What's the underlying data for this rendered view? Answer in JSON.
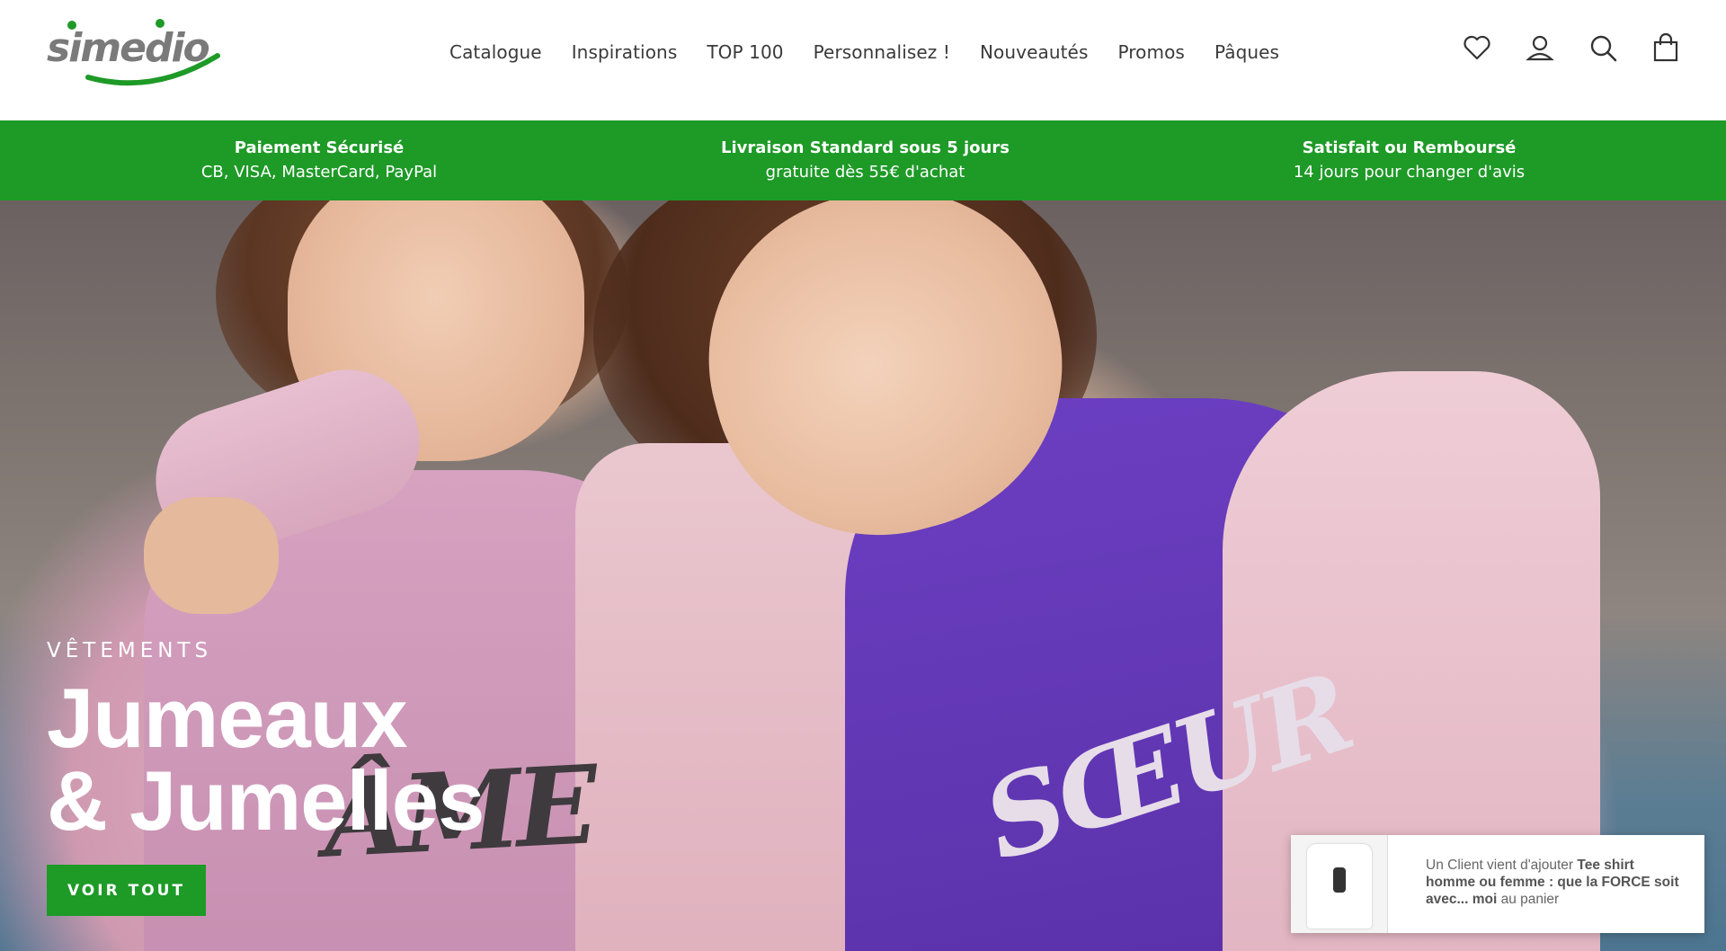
{
  "brand": {
    "logo_text": "simedio",
    "accent_color": "#1e9a27"
  },
  "nav": {
    "items": [
      {
        "label": "Catalogue"
      },
      {
        "label": "Inspirations"
      },
      {
        "label": "TOP 100"
      },
      {
        "label": "Personnalisez !"
      },
      {
        "label": "Nouveautés"
      },
      {
        "label": "Promos"
      },
      {
        "label": "Pâques"
      }
    ]
  },
  "header_icons": [
    "heart-icon",
    "account-icon",
    "search-icon",
    "cart-icon"
  ],
  "trust_bar": [
    {
      "title": "Paiement Sécurisé",
      "subtitle": "CB, VISA, MasterCard, PayPal"
    },
    {
      "title": "Livraison Standard sous 5 jours",
      "subtitle": "gratuite dès 55€ d'achat"
    },
    {
      "title": "Satisfait ou Remboursé",
      "subtitle": "14 jours pour changer d'avis"
    }
  ],
  "hero": {
    "eyebrow": "VÊTEMENTS",
    "title_line1": "Jumeaux",
    "title_line2": "& Jumelles",
    "button_label": "VOIR TOUT",
    "shirt_print_left": "ÂME",
    "shirt_print_right": "SŒUR"
  },
  "toast": {
    "prefix": "Un Client vient d'ajouter ",
    "product": "Tee shirt homme ou femme : que la FORCE soit avec... moi",
    "suffix": " au panier"
  }
}
